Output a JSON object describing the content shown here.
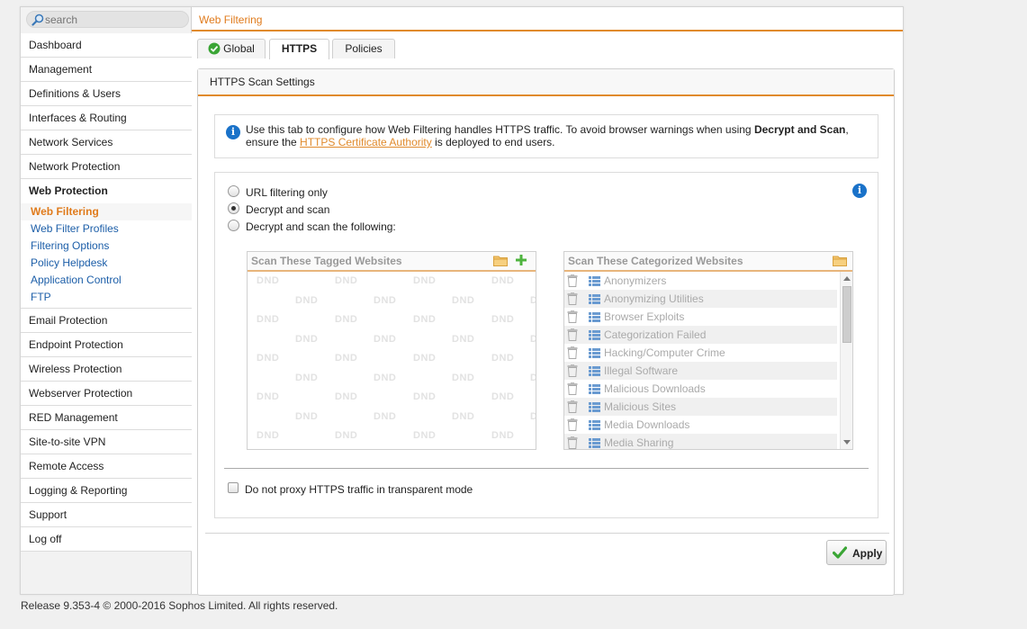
{
  "search": {
    "placeholder": "search"
  },
  "header": {
    "title": "Web Filtering"
  },
  "sidebar": {
    "items_top": [
      "Dashboard",
      "Management",
      "Definitions & Users",
      "Interfaces & Routing",
      "Network Services",
      "Network Protection"
    ],
    "active_section": "Web Protection",
    "sub_items": [
      "Web Filtering",
      "Web Filter Profiles",
      "Filtering Options",
      "Policy Helpdesk",
      "Application Control",
      "FTP"
    ],
    "items_bottom": [
      "Email Protection",
      "Endpoint Protection",
      "Wireless Protection",
      "Webserver Protection",
      "RED Management",
      "Site-to-site VPN",
      "Remote Access",
      "Logging & Reporting",
      "Support",
      "Log off"
    ]
  },
  "tabs": {
    "global": "Global",
    "https": "HTTPS",
    "policies": "Policies"
  },
  "panel": {
    "title": "HTTPS Scan Settings",
    "info": {
      "part1": "Use this tab to configure how Web Filtering handles HTTPS traffic. To avoid browser warnings when using ",
      "bold": "Decrypt and Scan",
      "part2": ",",
      "part3": "ensure the ",
      "link": "HTTPS Certificate Authority",
      "part4": " is deployed to end users."
    },
    "options": [
      "URL filtering only",
      "Decrypt and scan",
      "Decrypt and scan the following:"
    ],
    "selected_option": "Decrypt and scan",
    "tagged_title": "Scan These Tagged Websites",
    "dnd_text": "DND",
    "categorized_title": "Scan These Categorized Websites",
    "categories": [
      "Anonymizers",
      "Anonymizing Utilities",
      "Browser Exploits",
      "Categorization Failed",
      "Hacking/Computer Crime",
      "Illegal Software",
      "Malicious Downloads",
      "Malicious Sites",
      "Media Downloads",
      "Media Sharing"
    ],
    "no_proxy_label": "Do not proxy HTTPS traffic in transparent mode",
    "no_proxy_checked": false,
    "apply_label": "Apply"
  },
  "footer": "Release 9.353-4  © 2000-2016 Sophos Limited. All rights reserved.",
  "colors": {
    "accent": "#e08a2c",
    "link": "#1c5ea8",
    "info": "#1a72c9",
    "check": "#3aa535"
  }
}
